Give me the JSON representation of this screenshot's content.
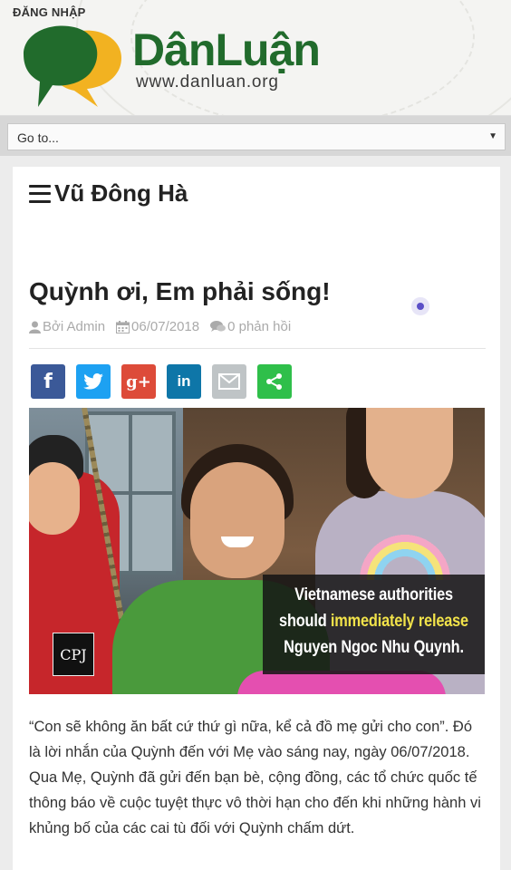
{
  "header": {
    "login_label": "ĐĂNG NHẬP",
    "site_name": "DânLuận",
    "site_url": "www.danluan.org"
  },
  "nav": {
    "selected": "Go to..."
  },
  "section": {
    "title": "Vũ Đông Hà"
  },
  "post": {
    "title": "Quỳnh ơi, Em phải sống!",
    "author": "Bởi Admin",
    "date": "06/07/2018",
    "comments": "0 phản hồi",
    "image_caption_1": "Vietnamese authorities",
    "image_caption_2a": "should ",
    "image_caption_2b": "immediately release",
    "image_caption_3": "Nguyen Ngoc Nhu Quynh.",
    "image_logo": "CPJ",
    "body": "“Con sẽ không ăn bất cứ thứ gì nữa, kể cả đồ mẹ gửi cho con”. Đó là lời nhắn của Quỳnh đến với Mẹ vào sáng nay, ngày 06/07/2018. Qua Mẹ, Quỳnh đã gửi đến bạn bè, cộng đồng, các tổ chức quốc tế thông báo về cuộc tuyệt thực vô thời hạn cho đến khi những hành vi khủng bố của các cai tù đối với Quỳnh chấm dứt."
  },
  "share": [
    {
      "name": "facebook-icon",
      "label": "f",
      "color": "#3b5998"
    },
    {
      "name": "twitter-icon",
      "label": "",
      "color": "#1da1f2"
    },
    {
      "name": "google-plus-icon",
      "label": "g+",
      "color": "#dd4b39"
    },
    {
      "name": "linkedin-icon",
      "label": "in",
      "color": "#0e76a8"
    },
    {
      "name": "email-icon",
      "label": "",
      "color": "#bfc4c6"
    },
    {
      "name": "share-icon",
      "label": "",
      "color": "#2fbf4a"
    }
  ],
  "colors": {
    "brand_green": "#216b2c",
    "brand_yellow": "#f2b221",
    "highlight_yellow": "#f2e34a"
  }
}
